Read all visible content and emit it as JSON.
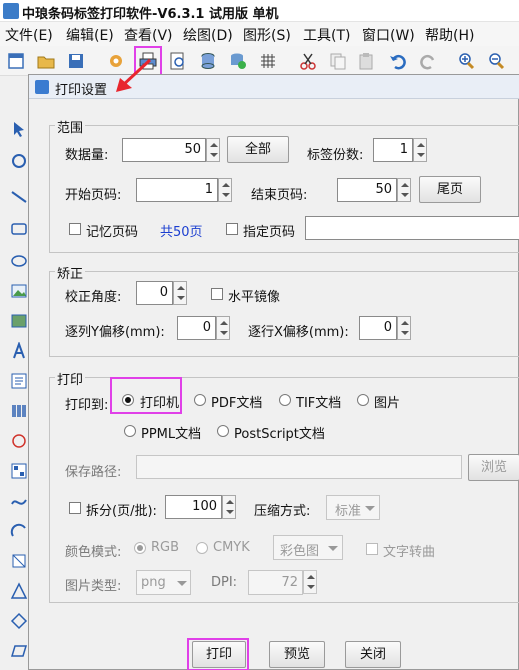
{
  "app": {
    "title": "中琅条码标签打印软件-V6.3.1 试用版 单机"
  },
  "menu": [
    "文件(E)",
    "编辑(E)",
    "查看(V)",
    "绘图(D)",
    "图形(S)",
    "工具(T)",
    "窗口(W)",
    "帮助(H)"
  ],
  "colors": {
    "highlight": "#e040e8",
    "link": "#1c3fd0",
    "arrow": "#e8262e"
  },
  "dialog": {
    "title": "打印设置",
    "range": {
      "legend": "范围",
      "data_count_label": "数据量:",
      "data_count": "50",
      "all_button": "全部",
      "copies_label": "标签份数:",
      "copies": "1",
      "start_page_label": "开始页码:",
      "start_page": "1",
      "end_page_label": "结束页码:",
      "end_page": "50",
      "last_page_button": "尾页",
      "remember_page": "记忆页码",
      "total_pages": "共50页",
      "specify_page": "指定页码"
    },
    "correction": {
      "legend": "矫正",
      "angle_label": "校正角度:",
      "angle": "0",
      "mirror": "水平镜像",
      "y_offset_label": "逐列Y偏移(mm):",
      "y_offset": "0",
      "x_offset_label": "逐行X偏移(mm):",
      "x_offset": "0"
    },
    "print": {
      "legend": "打印",
      "print_to_label": "打印到:",
      "targets": [
        "打印机",
        "PDF文档",
        "TIF文档",
        "图片",
        "PPML文档",
        "PostScript文档"
      ],
      "selected": "打印机",
      "save_path_label": "保存路径:",
      "browse_button": "浏览",
      "split_label": "拆分(页/批):",
      "split_value": "100",
      "compress_label": "压缩方式:",
      "compress_value": "标准",
      "color_mode_label": "颜色模式:",
      "rgb": "RGB",
      "cmyk": "CMYK",
      "color_type": "彩色图",
      "text_to_curve": "文字转曲",
      "image_type_label": "图片类型:",
      "image_type": "png",
      "dpi_label": "DPI:",
      "dpi": "72"
    },
    "buttons": {
      "print": "打印",
      "preview": "预览",
      "close": "关闭"
    }
  }
}
